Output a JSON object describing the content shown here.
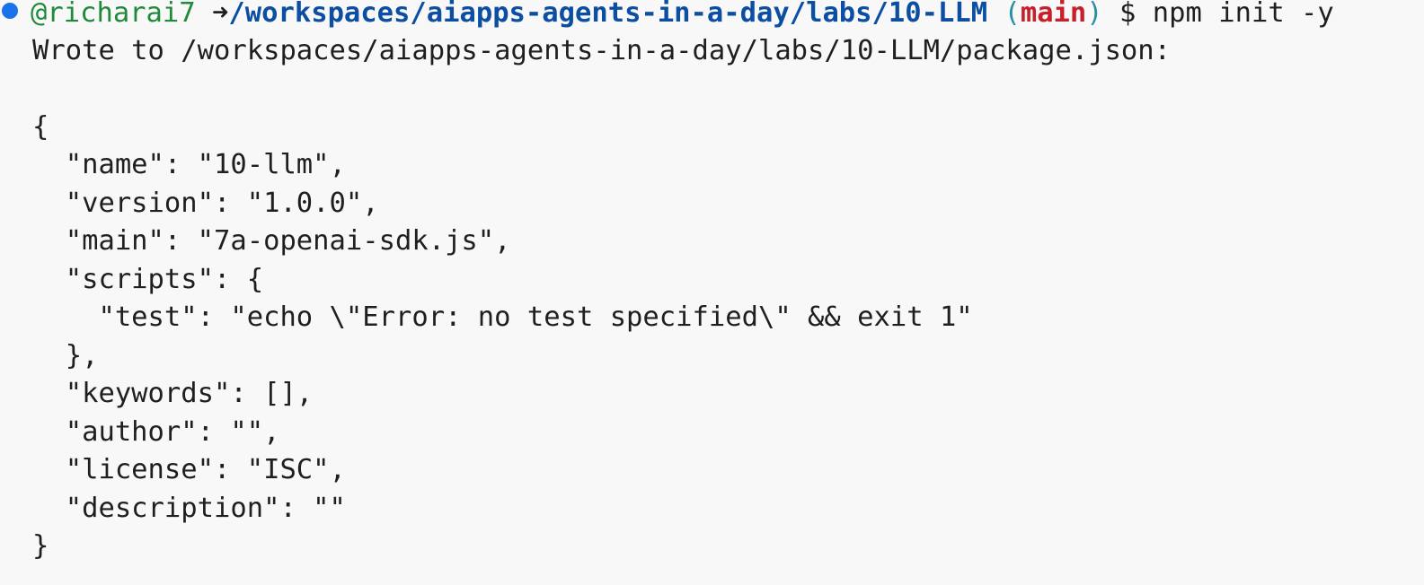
{
  "prompt": {
    "user": "@richarai7",
    "arrow": "➜",
    "cwd": "/workspaces/aiapps-agents-in-a-day/labs/10-LLM",
    "paren_open": "(",
    "branch": "main",
    "paren_close": ")",
    "symbol": "$",
    "command": "npm init -y",
    "status_color": "#1a73e8"
  },
  "output": [
    "Wrote to /workspaces/aiapps-agents-in-a-day/labs/10-LLM/package.json:",
    "",
    "{",
    "  \"name\": \"10-llm\",",
    "  \"version\": \"1.0.0\",",
    "  \"main\": \"7a-openai-sdk.js\",",
    "  \"scripts\": {",
    "    \"test\": \"echo \\\"Error: no test specified\\\" && exit 1\"",
    "  },",
    "  \"keywords\": [],",
    "  \"author\": \"\",",
    "  \"license\": \"ISC\",",
    "  \"description\": \"\"",
    "}"
  ]
}
